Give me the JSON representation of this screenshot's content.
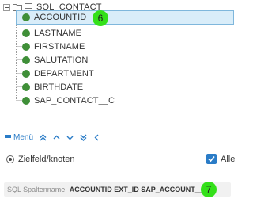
{
  "tree": {
    "root_label": "SQL_CONTACT",
    "nodes": [
      {
        "label": "ACCOUNTID",
        "selected": true
      },
      {
        "label": "LASTNAME",
        "selected": false
      },
      {
        "label": "FIRSTNAME",
        "selected": false
      },
      {
        "label": "SALUTATION",
        "selected": false
      },
      {
        "label": "DEPARTMENT",
        "selected": false
      },
      {
        "label": "BIRTHDATE",
        "selected": false
      },
      {
        "label": "SAP_CONTACT__C",
        "selected": false
      }
    ],
    "badge": "6"
  },
  "toolbar": {
    "menu_label": "Menü",
    "icons": [
      "double-chevron-up-icon",
      "chevron-up-icon",
      "chevron-down-icon",
      "double-chevron-down-icon",
      "chevron-left-icon"
    ]
  },
  "options": {
    "radio_label": "Zielfeld/knoten",
    "radio_checked": true,
    "checkbox_label": "Alle",
    "checkbox_checked": true
  },
  "sql": {
    "label": "SQL Spaltenname:",
    "value": "ACCOUNTID EXT_ID SAP_ACCOUNT__C",
    "badge": "7"
  },
  "colors": {
    "accent": "#2a7cc7",
    "node_dot": "#3f8f38",
    "badge": "#34e01a",
    "selection": "#d9edf9"
  }
}
